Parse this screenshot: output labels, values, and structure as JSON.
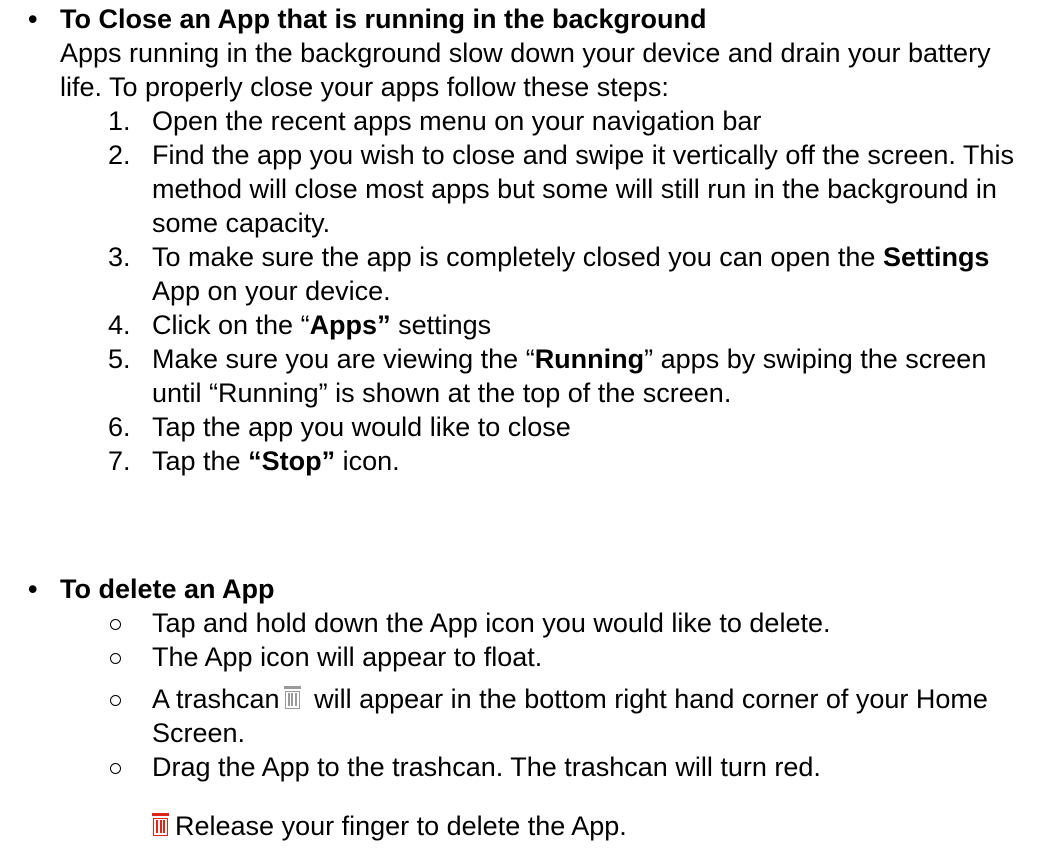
{
  "section1": {
    "bullet": "•",
    "title": "To Close an App that is running in the background",
    "intro": "Apps running in the background slow down your device and drain your battery life. To properly close your apps follow these steps:",
    "steps": [
      {
        "num": "1.",
        "text": "Open the recent apps menu on your navigation bar"
      },
      {
        "num": "2.",
        "text": "Find the app you wish to close and swipe it vertically off the screen. This method will close most apps but some will still run in the background in some capacity."
      },
      {
        "num": "3.",
        "before": "To make sure the app is completely closed you can open the ",
        "bold": "Settings",
        "after": " App on your device."
      },
      {
        "num": "4.",
        "before": "Click on the “",
        "bold": "Apps”",
        "after": " settings"
      },
      {
        "num": "5.",
        "before": "Make sure you are viewing the “",
        "bold": "Running",
        "after": "” apps by swiping the screen until “Running” is shown at the top of the screen."
      },
      {
        "num": "6.",
        "text": "Tap the app you would like to close"
      },
      {
        "num": "7.",
        "before": "Tap the ",
        "bold": "“Stop”",
        "after": " icon."
      }
    ]
  },
  "section2": {
    "bullet": "•",
    "title": "To delete an App",
    "items": [
      {
        "text": "Tap and hold down the App icon you would like to delete."
      },
      {
        "text": "The App icon will appear to float."
      },
      {
        "before": "A trashcan",
        "after": " will appear in the bottom right hand corner of your Home Screen.",
        "icon": "trashcan-gray-icon"
      },
      {
        "text": "Drag the App to the trashcan. The trashcan will turn red."
      }
    ],
    "release": {
      "icon": "trashcan-red-icon",
      "text": "Release your finger to delete the App."
    }
  },
  "colors": {
    "trash_gray": "#9a9a9a",
    "trash_red": "#e0241b"
  }
}
